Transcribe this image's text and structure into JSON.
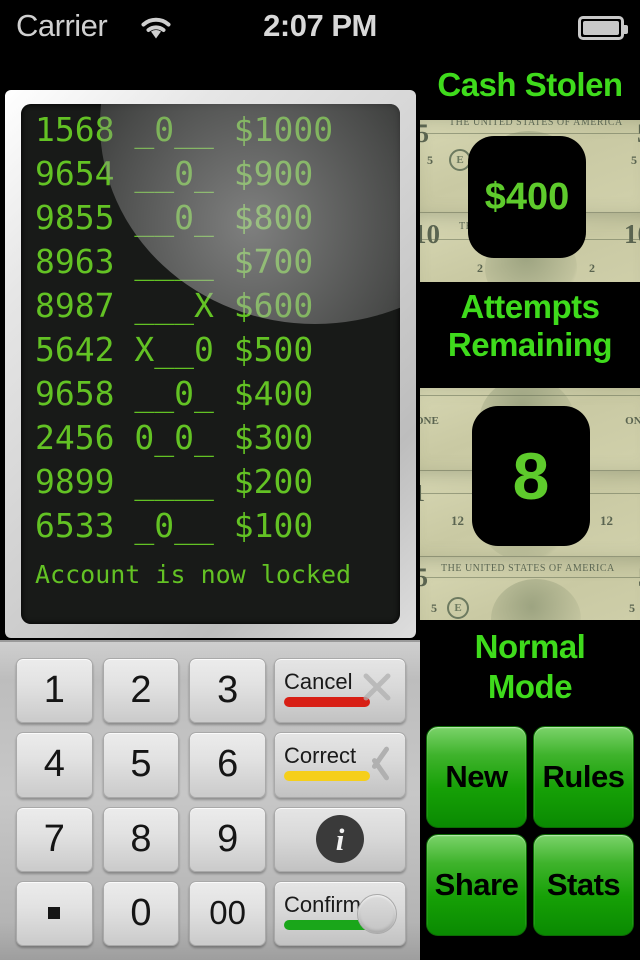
{
  "status_bar": {
    "carrier": "Carrier",
    "wifi_icon": "wifi-icon",
    "time": "2:07 PM",
    "battery_icon": "battery-icon"
  },
  "atm_display": {
    "rows": [
      {
        "code": "1568",
        "pattern": "_0__",
        "amount": "$1000"
      },
      {
        "code": "9654",
        "pattern": "__0_",
        "amount": "$900"
      },
      {
        "code": "9855",
        "pattern": "__0_",
        "amount": "$800"
      },
      {
        "code": "8963",
        "pattern": "____",
        "amount": "$700"
      },
      {
        "code": "8987",
        "pattern": "___X",
        "amount": "$600"
      },
      {
        "code": "5642",
        "pattern": "X__0",
        "amount": "$500"
      },
      {
        "code": "9658",
        "pattern": "__0_",
        "amount": "$400"
      },
      {
        "code": "2456",
        "pattern": "0_0_",
        "amount": "$300"
      },
      {
        "code": "9899",
        "pattern": "____",
        "amount": "$200"
      },
      {
        "code": "6533",
        "pattern": "_0__",
        "amount": "$100"
      }
    ],
    "message": "Account is now locked",
    "screen_color": "#63c224"
  },
  "keypad": {
    "keys": [
      "1",
      "2",
      "3",
      "4",
      "5",
      "6",
      "7",
      "8",
      "9",
      ".",
      "0",
      "00"
    ],
    "side_keys": [
      {
        "label": "Cancel",
        "bar_color": "#d81f15",
        "icon": "close-x-icon"
      },
      {
        "label": "Correct",
        "bar_color": "#f5cf1b",
        "icon": "chevron-left-icon"
      },
      {
        "label": "",
        "bar_color": "",
        "icon": "info-icon"
      },
      {
        "label": "Confirm",
        "bar_color": "#1aa61a",
        "icon": "circle-button-icon"
      }
    ],
    "info_glyph": "i"
  },
  "right_panel": {
    "cash_stolen": {
      "heading": "Cash Stolen",
      "value": "$400"
    },
    "attempts": {
      "heading_line1": "Attempts",
      "heading_line2": "Remaining",
      "value": "8"
    },
    "mode": {
      "line1": "Normal",
      "line2": "Mode"
    },
    "buttons": [
      {
        "label": "New"
      },
      {
        "label": "Rules"
      },
      {
        "label": "Share"
      },
      {
        "label": "Stats"
      }
    ],
    "heading_color": "#3fdb1c",
    "value_color": "#5ecb2c"
  }
}
